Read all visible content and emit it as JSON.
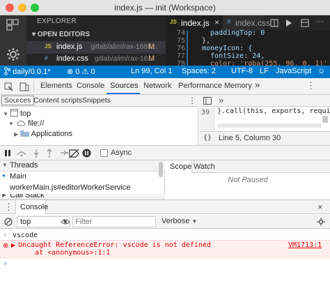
{
  "window": {
    "title": "index.js — init (Workspace)"
  },
  "explorer": {
    "title": "EXPLORER",
    "section": "▾ OPEN EDITORS",
    "files": [
      {
        "icon": "JS",
        "name": "index.js",
        "path": "gitlab/alim/rax-1688...",
        "status": "M"
      },
      {
        "icon": "#",
        "name": "index.css",
        "path": "gitlab/alim/rax-16...",
        "status": "M"
      }
    ]
  },
  "editor": {
    "tabs": [
      {
        "name": "index.js",
        "close": "×"
      },
      {
        "name": "index.css"
      }
    ],
    "lines": [
      {
        "num": "74",
        "text": "  paddingTop: 0"
      },
      {
        "num": "75",
        "text": "},"
      },
      {
        "num": "76",
        "text": "moneyIcon: {"
      },
      {
        "num": "77",
        "text": "  fontSize: 24,"
      },
      {
        "num": "78",
        "text": "  color: 'rgba(255, 96, 0, 1)'"
      }
    ]
  },
  "statusbar": {
    "branch": "daily/0.0.1*",
    "errors": "0",
    "warnings": "0",
    "cursor": "Ln 99, Col 1",
    "spaces": "Spaces: 2",
    "encoding": "UTF-8",
    "eol": "LF",
    "language": "JavaScript"
  },
  "devtools": {
    "tabs": [
      "Elements",
      "Console",
      "Sources",
      "Network",
      "Performance",
      "Memory"
    ],
    "active_tab": "Sources",
    "more": "»"
  },
  "navigator": {
    "tabs": [
      "Sources",
      "Content scripts",
      "Snippets"
    ],
    "tree": [
      "top",
      "file://",
      "Applications"
    ]
  },
  "source_pane": {
    "more": "»",
    "line_num": "39",
    "code": "}.call(this, exports, require,",
    "format_icon": "{}",
    "position": "Line 5, Column 30"
  },
  "debugger": {
    "async_label": "Async",
    "threads_header": "Threads",
    "threads": [
      "Main",
      "workerMain.js#editorWorkerService"
    ],
    "callstack_header": "Call Stack",
    "tabs": [
      "Scope",
      "Watch"
    ],
    "not_paused": "Not Paused"
  },
  "console": {
    "tab": "Console",
    "context": "top",
    "filter_placeholder": "Filter",
    "level": "Verbose",
    "input_echo": "vscode",
    "error_message": "Uncaught ReferenceError: vscode is not defined",
    "error_stack": "    at <anonymous>:1:1",
    "error_location": "VM1713:1",
    "prompt": "›"
  },
  "colors": {
    "statusbar": "#007acc",
    "editor_bg": "#1e1e1e",
    "sidebar_bg": "#252526",
    "active_tab": "#1a73e8",
    "error_text": "#d80000"
  }
}
